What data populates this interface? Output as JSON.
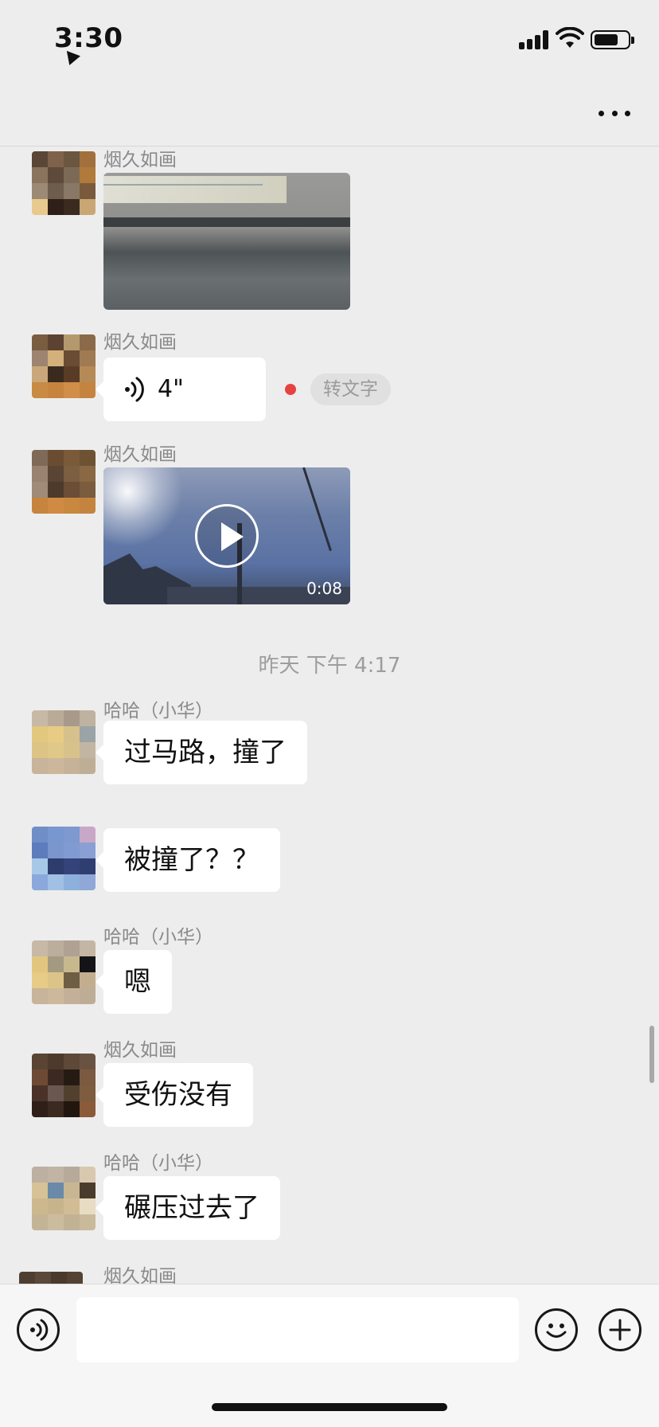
{
  "status_bar": {
    "time": "3:30"
  },
  "messages": [
    {
      "sender": "烟久如画",
      "type": "image"
    },
    {
      "sender": "烟久如画",
      "type": "voice",
      "duration": "4\"",
      "to_text": "转文字"
    },
    {
      "sender": "烟久如画",
      "type": "video",
      "duration": "0:08"
    },
    {
      "type": "timestamp",
      "text": "昨天 下午 4:17"
    },
    {
      "sender": "哈哈（小华）",
      "type": "text",
      "text": "过马路，撞了"
    },
    {
      "sender": "",
      "type": "text",
      "text": "被撞了？？"
    },
    {
      "sender": "哈哈（小华）",
      "type": "text",
      "text": "嗯"
    },
    {
      "sender": "烟久如画",
      "type": "text",
      "text": "受伤没有"
    },
    {
      "sender": "哈哈（小华）",
      "type": "text",
      "text": "碾压过去了"
    },
    {
      "sender": "烟久如画",
      "type": "text",
      "text": ""
    }
  ],
  "colors": {
    "background": "#ededed",
    "bubble": "#ffffff",
    "unread_dot": "#e64340"
  },
  "icons": [
    "location-arrow-icon",
    "signal-icon",
    "wifi-icon",
    "battery-icon",
    "more-icon",
    "voice-wave-icon",
    "play-icon",
    "voice-input-icon",
    "emoji-icon",
    "plus-icon"
  ]
}
